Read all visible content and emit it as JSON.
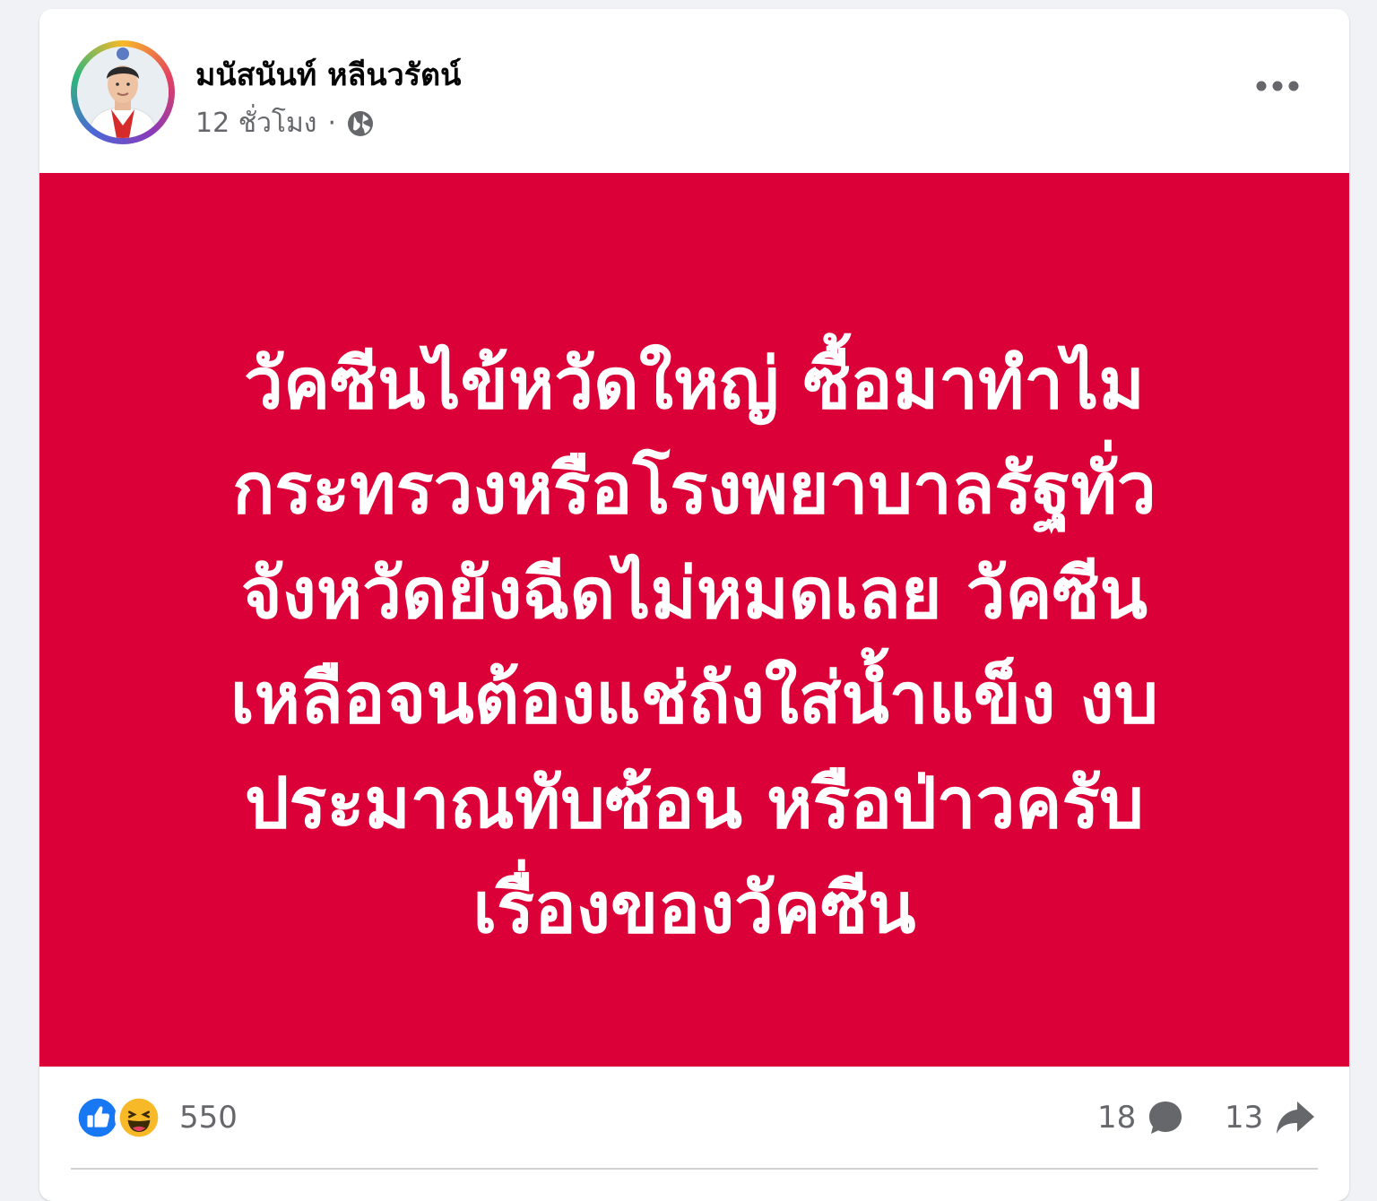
{
  "post": {
    "author_name": "มนัสนันท์ หลีนวรัตน์",
    "timestamp": "12 ชั่วโมง",
    "separator": "·",
    "audience_icon": "globe-icon",
    "more_icon": "more-horizontal-icon",
    "background_color": "#dc0038",
    "text_lines": [
      "วัคซีนไข้หวัดใหญ่ ซื้อมาทำไม",
      "กระทรวงหรือโรงพยาบาลรัฐทั่ว",
      "จังหวัดยังฉีดไม่หมดเลย วัคซีน",
      "เหลือจนต้องแช่ถังใส่น้ำแข็ง งบ",
      "ประมาณทับซ้อน หรือป่าวครับ",
      "เรื่องของวัคซีน"
    ]
  },
  "footer": {
    "reaction_icons": [
      "like-icon",
      "haha-icon"
    ],
    "reaction_count": "550",
    "comment_count": "18",
    "comment_icon": "comment-icon",
    "share_count": "13",
    "share_icon": "share-icon"
  },
  "colors": {
    "like_blue": "#1877f2",
    "haha_yellow": "#f7b928",
    "text_secondary": "#65676b"
  }
}
